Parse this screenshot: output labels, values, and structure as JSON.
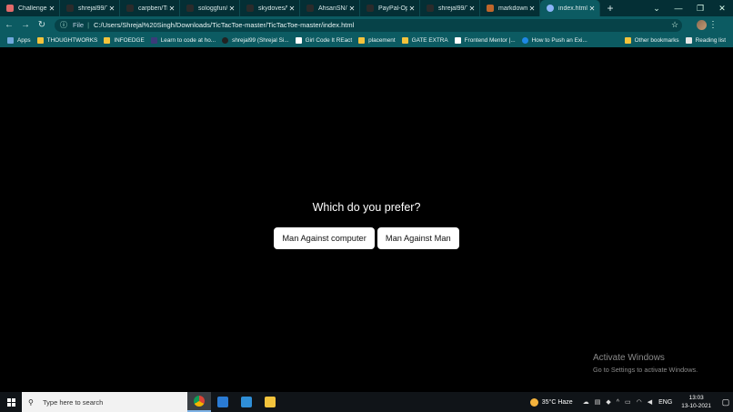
{
  "browser": {
    "tabs": [
      {
        "title": "Challenge",
        "color": "#e36a6a"
      },
      {
        "title": "shrejal99/Ti",
        "color": "#2b2b2b"
      },
      {
        "title": "carpben/Tic",
        "color": "#2b2b2b"
      },
      {
        "title": "sologgfun/j",
        "color": "#2b2b2b"
      },
      {
        "title": "skydoves/W",
        "color": "#2b2b2b"
      },
      {
        "title": "AhsanSN/T",
        "color": "#2b2b2b"
      },
      {
        "title": "PayPal-Opp",
        "color": "#2b2b2b"
      },
      {
        "title": "shrejal99/Ti",
        "color": "#2b2b2b"
      },
      {
        "title": "markdown",
        "color": "#c0662b"
      },
      {
        "title": "index.html",
        "color": "#8ab4f8",
        "active": true
      }
    ],
    "new_tab_glyph": "+",
    "window_controls": [
      "⌄",
      "—",
      "❐",
      "✕"
    ],
    "address": {
      "scheme": "File",
      "url": "C:/Users/Shrejal%20Singh/Downloads/TicTacToe-master/TicTacToe-master/index.html"
    },
    "bookmarks": [
      {
        "label": "Apps",
        "icon": "apps-grid-icon",
        "color": "#6fa8dc"
      },
      {
        "label": "THOUGHTWORKS",
        "icon": "folder-icon",
        "color": "#f3c33c"
      },
      {
        "label": "INFOEDGE",
        "icon": "folder-icon",
        "color": "#f3c33c"
      },
      {
        "label": "Learn to code at ho...",
        "icon": "site-icon",
        "color": "#3b3b7a"
      },
      {
        "label": "shrejal99 (Shrejal Si...",
        "icon": "github-icon",
        "color": "#222222"
      },
      {
        "label": "Girl Code It REact",
        "icon": "site-icon",
        "color": "#ffffff"
      },
      {
        "label": "placement",
        "icon": "folder-icon",
        "color": "#f3c33c"
      },
      {
        "label": "GATE EXTRA",
        "icon": "folder-icon",
        "color": "#f3c33c"
      },
      {
        "label": "Frontend Mentor |...",
        "icon": "site-icon",
        "color": "#ffffff"
      },
      {
        "label": "How to Push an Exi...",
        "icon": "site-icon",
        "color": "#1e88e5"
      }
    ],
    "bookmarks_right": [
      {
        "label": "Other bookmarks",
        "icon": "folder-icon",
        "color": "#f3c33c"
      },
      {
        "label": "Reading list",
        "icon": "reading-list-icon",
        "color": "#e6e6e6"
      }
    ]
  },
  "page": {
    "prompt": "Which do you prefer?",
    "buttons": [
      "Man Against computer",
      "Man Against Man"
    ]
  },
  "watermark": {
    "title": "Activate Windows",
    "subtitle": "Go to Settings to activate Windows."
  },
  "taskbar": {
    "search_placeholder": "Type here to search",
    "weather": "35°C  Haze",
    "language": "ENG",
    "time": "13:03",
    "date": "13-10-2021"
  }
}
